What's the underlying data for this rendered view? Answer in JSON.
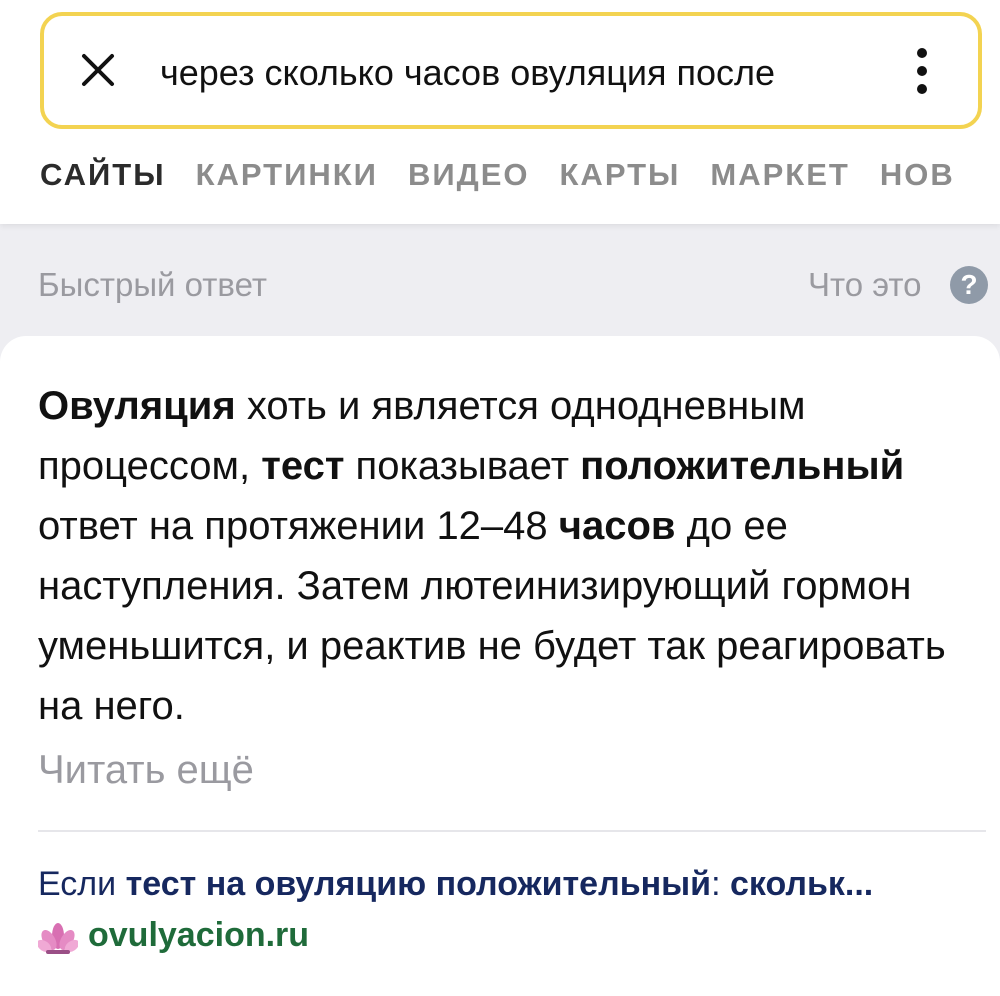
{
  "search": {
    "query": "через сколько часов овуляция после",
    "close_icon": "close-icon",
    "menu_icon": "kebab-menu-icon"
  },
  "tabs": [
    "САЙТЫ",
    "КАРТИНКИ",
    "ВИДЕО",
    "КАРТЫ",
    "МАРКЕТ",
    "НОВ"
  ],
  "quick_answer": {
    "title": "Быстрый ответ",
    "what_is_this": "Что это",
    "help_icon": "?",
    "answer": {
      "p1_bold": "Овуляция",
      "p1": " хоть и является однодневным процессом, ",
      "p2_bold": "тест",
      "p2": " показывает ",
      "p3_bold": "положительный",
      "p3": " ответ на протяжении 12–48 ",
      "p4_bold": "часов",
      "p4": " до ее наступления. Затем лютеинизирующий гормон уменьшится, и реактив не будет так реагировать на него."
    },
    "read_more": "Читать ещё"
  },
  "source": {
    "title_prefix": "Если ",
    "title_bold": "тест на овуляцию положительный",
    "title_suffix": ": ",
    "title_bold2": "скольк...",
    "domain": "ovulyacion.ru",
    "favicon": "lotus-icon"
  },
  "colors": {
    "search_border": "#f3d351",
    "background_gray": "#eeeef2",
    "link_blue": "#16285f",
    "domain_green": "#1f6b3a"
  }
}
